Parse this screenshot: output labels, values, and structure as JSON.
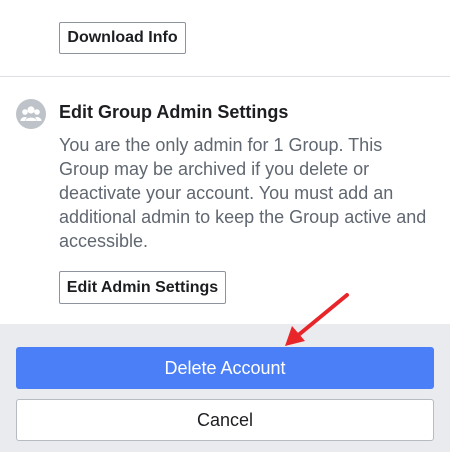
{
  "download_section": {
    "download_button_label": "Download Info"
  },
  "group_admin_section": {
    "icon": "group-icon",
    "title": "Edit Group Admin Settings",
    "body": "You are the only admin for 1 Group. This Group may be archived if you delete or deactivate your account. You must add an additional admin to keep the Group active and accessible.",
    "edit_button_label": "Edit Admin Settings"
  },
  "footer": {
    "delete_button_label": "Delete Account",
    "cancel_button_label": "Cancel"
  },
  "annotation": {
    "arrow_icon": "red-arrow-icon",
    "arrow_color": "#e8262a"
  },
  "colors": {
    "primary": "#4b7ff7",
    "panel_bg": "#e9ebee",
    "body_text": "#606770",
    "title_text": "#1c1e21"
  }
}
